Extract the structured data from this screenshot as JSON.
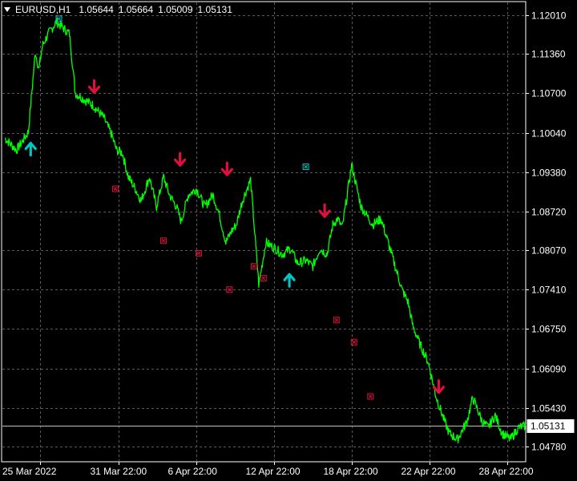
{
  "header": {
    "symbol": "EURUSD,H1",
    "open": "1.05644",
    "high": "1.05664",
    "low": "1.05009",
    "close": "1.05131"
  },
  "colors": {
    "background": "#000000",
    "grid": "#5a5a5a",
    "price_line": "#00ff00",
    "text": "#ffffff",
    "buy_arrow": "#00c5c5",
    "sell_arrow": "#e0103c",
    "exit_marker": "#e0103c",
    "exit_marker_buy": "#00c5c5",
    "current_price_line": "#c0c0c0"
  },
  "chart_data": {
    "type": "line",
    "xlabel": "",
    "ylabel": "",
    "ylim": [
      1.0445,
      1.1255
    ],
    "grid": true,
    "y_ticks": [
      "1.12010",
      "1.11360",
      "1.10700",
      "1.10040",
      "1.09380",
      "1.08720",
      "1.08070",
      "1.07410",
      "1.06750",
      "1.06090",
      "1.05430",
      "1.04780"
    ],
    "x_ticks": [
      {
        "label": "25 Mar 2022",
        "bar": 0
      },
      {
        "label": "31 Mar 22:00",
        "bar": 134
      },
      {
        "label": "6 Apr 22:00",
        "bar": 266
      },
      {
        "label": "12 Apr 22:00",
        "bar": 398
      },
      {
        "label": "18 Apr 22:00",
        "bar": 530
      },
      {
        "label": "22 Apr 22:00",
        "bar": 662
      },
      {
        "label": "28 Apr 22:00",
        "bar": 794
      }
    ],
    "current_price": "1.05131",
    "series": [
      {
        "key": "close",
        "bars": [
          0,
          20,
          40,
          52,
          58,
          64,
          74,
          88,
          110,
          120,
          135,
          150,
          168,
          182,
          190,
          200,
          210,
          222,
          232,
          246,
          258,
          270,
          280,
          292,
          300,
          312,
          326,
          340,
          354,
          364,
          376,
          386,
          394,
          404,
          418,
          432,
          444,
          460,
          472,
          486,
          498,
          512,
          524,
          536,
          548,
          558,
          566,
          574,
          590,
          606,
          616,
          626,
          640,
          652,
          664,
          676,
          686,
          694,
          706,
          720,
          734,
          748,
          756,
          770,
          786,
          796,
          804,
          812,
          822,
          834,
          846,
          860,
          874,
          886
        ],
        "values": [
          1.0995,
          1.0975,
          1.1005,
          1.114,
          1.111,
          1.115,
          1.117,
          1.119,
          1.117,
          1.107,
          1.106,
          1.105,
          1.103,
          1.1,
          1.0975,
          1.097,
          1.093,
          1.091,
          1.089,
          1.093,
          1.088,
          1.093,
          1.09,
          1.088,
          1.0855,
          1.09,
          1.091,
          1.088,
          1.09,
          1.087,
          1.082,
          1.084,
          1.085,
          1.089,
          1.0925,
          1.075,
          1.082,
          1.081,
          1.08,
          1.081,
          1.0785,
          1.079,
          1.078,
          1.081,
          1.08,
          1.085,
          1.086,
          1.0845,
          1.095,
          1.088,
          1.0865,
          1.085,
          1.086,
          1.082,
          1.078,
          1.074,
          1.072,
          1.068,
          1.065,
          1.062,
          1.056,
          1.052,
          1.05,
          1.049,
          1.052,
          1.056,
          1.054,
          1.052,
          1.051,
          1.053,
          1.05,
          1.049,
          1.051,
          1.0513
        ]
      }
    ],
    "signals": [
      {
        "type": "buy",
        "bar": 44,
        "price": 1.0988
      },
      {
        "type": "sell",
        "bar": 152,
        "price": 1.107
      },
      {
        "type": "sell",
        "bar": 298,
        "price": 1.0948
      },
      {
        "type": "sell",
        "bar": 378,
        "price": 1.0932
      },
      {
        "type": "buy",
        "bar": 484,
        "price": 1.0768
      },
      {
        "type": "sell",
        "bar": 544,
        "price": 1.0862
      },
      {
        "type": "sell",
        "bar": 738,
        "price": 1.0567
      }
    ],
    "exits": [
      {
        "bar": 92,
        "price": 1.1195,
        "side": "buy"
      },
      {
        "bar": 188,
        "price": 1.091,
        "side": "sell"
      },
      {
        "bar": 270,
        "price": 1.0823,
        "side": "sell"
      },
      {
        "bar": 330,
        "price": 1.0802,
        "side": "sell"
      },
      {
        "bar": 382,
        "price": 1.0741,
        "side": "sell"
      },
      {
        "bar": 424,
        "price": 1.078,
        "side": "sell"
      },
      {
        "bar": 440,
        "price": 1.076,
        "side": "sell"
      },
      {
        "bar": 512,
        "price": 1.0947,
        "side": "buy"
      },
      {
        "bar": 564,
        "price": 1.069,
        "side": "sell"
      },
      {
        "bar": 594,
        "price": 1.0653,
        "side": "sell"
      },
      {
        "bar": 622,
        "price": 1.0562,
        "side": "sell"
      }
    ]
  }
}
